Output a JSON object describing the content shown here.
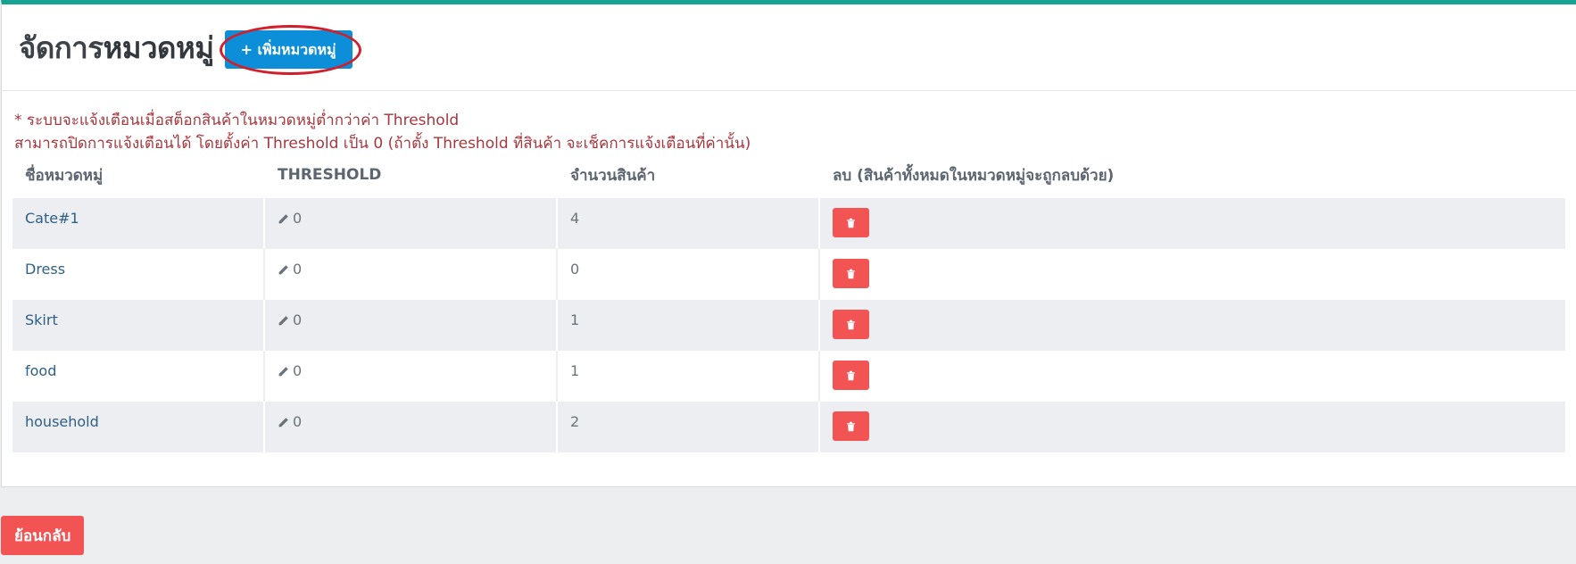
{
  "header": {
    "title_prefix": "จัดการ",
    "title_bold": "หมวดหมู่",
    "add_button_label": "+ เพิ่มหมวดหมู่"
  },
  "notes": {
    "line1": "* ระบบจะแจ้งเตือนเมื่อสต็อกสินค้าในหมวดหมู่ต่ำกว่าค่า Threshold",
    "line2": "สามารถปิดการแจ้งเตือนได้ โดยตั้งค่า Threshold เป็น 0 (ถ้าตั้ง Threshold ที่สินค้า จะเช็คการแจ้งเตือนที่ค่านั้น)"
  },
  "table": {
    "headers": [
      "ชื่อหมวดหมู่",
      "THRESHOLD",
      "จำนวนสินค้า",
      "ลบ (สินค้าทั้งหมดในหมวดหมู่จะถูกลบด้วย)"
    ],
    "rows": [
      {
        "name": "Cate#1",
        "threshold": "0",
        "count": "4"
      },
      {
        "name": "Dress",
        "threshold": "0",
        "count": "0"
      },
      {
        "name": "Skirt",
        "threshold": "0",
        "count": "1"
      },
      {
        "name": "food",
        "threshold": "0",
        "count": "1"
      },
      {
        "name": "household",
        "threshold": "0",
        "count": "2"
      }
    ]
  },
  "footer": {
    "back_button_label": "ย้อนกลับ"
  },
  "icons": {
    "edit": "pencil-icon",
    "delete": "trash-icon"
  },
  "colors": {
    "accent_top": "#16a394",
    "primary_button": "#0c8fd8",
    "danger_button": "#f25454",
    "note_text": "#a6373d",
    "highlight_ring": "#d11f2b"
  }
}
